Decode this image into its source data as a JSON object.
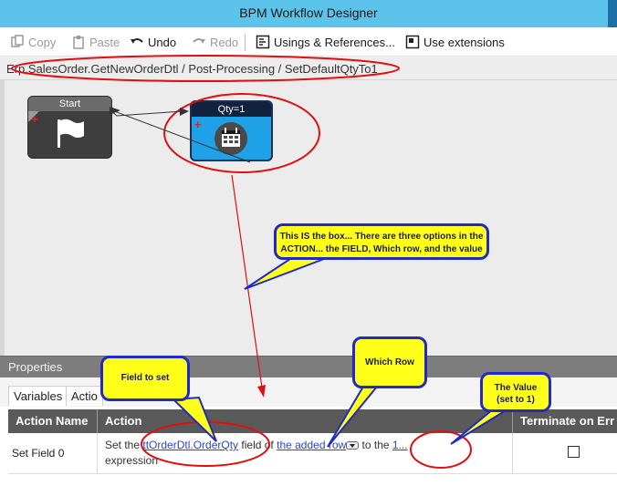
{
  "window": {
    "title": "BPM Workflow Designer"
  },
  "toolbar": {
    "copy": "Copy",
    "paste": "Paste",
    "undo": "Undo",
    "redo": "Redo",
    "usings": "Usings & References...",
    "use_ext": "Use extensions"
  },
  "breadcrumb": "Erp.SalesOrder.GetNewOrderDtl / Post-Processing / SetDefaultQtyTo1",
  "canvas": {
    "start_node": {
      "label": "Start",
      "icon": "flag-icon"
    },
    "qty_node": {
      "label": "Qty=1",
      "icon": "calendar-icon"
    }
  },
  "callouts": {
    "box_line1": "This IS the box... There are three options in the",
    "box_line2": "ACTION... the FIELD, Which row, and the value",
    "field_to_set": "Field to set",
    "which_row": "Which Row",
    "the_value_line1": "The Value",
    "the_value_line2": "(set to 1)"
  },
  "properties": {
    "header": "Properties",
    "tabs": [
      "Variables",
      "Actio"
    ],
    "columns": [
      "Action Name",
      "Action",
      "Terminate on Err"
    ],
    "row": {
      "name": "Set Field 0",
      "set_the": "Set the",
      "field_link": "ttOrderDtl.OrderQty",
      "field_of": "field of",
      "row_link": "the added row",
      "to_the": "to the",
      "value_link": "1...",
      "expression": "expression"
    }
  },
  "colors": {
    "title_bar": "#5cc3ea",
    "callout_fill": "#ffff1a",
    "callout_border": "#1f2ac8",
    "annotation_red": "#e01010"
  }
}
